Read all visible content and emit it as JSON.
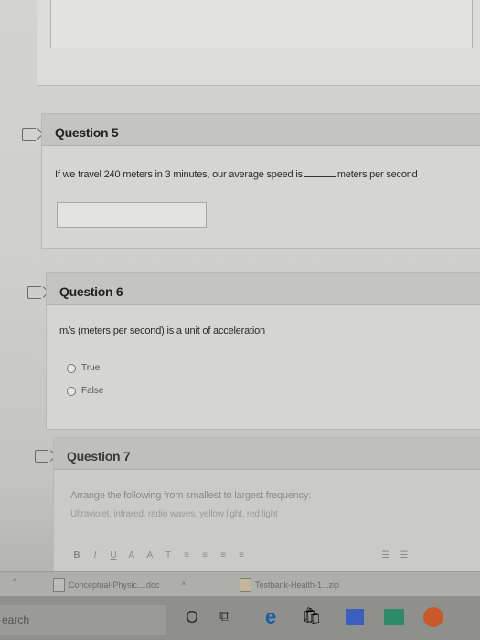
{
  "q5": {
    "title": "Question 5",
    "text_before": "If we travel 240 meters in 3 minutes, our average speed is",
    "text_after": "meters per second",
    "answer_value": ""
  },
  "q6": {
    "title": "Question 6",
    "text": "m/s (meters per second) is a unit of acceleration",
    "options": [
      "True",
      "False"
    ]
  },
  "q7": {
    "title": "Question 7",
    "text": "Arrange the following from smallest to largest frequency:",
    "items": "Ultraviolet, infrared, radio waves, yellow light, red light"
  },
  "editor_toolbar": {
    "bold": "B",
    "italic": "I",
    "underline": "U",
    "font_color": "A",
    "highlight": "A",
    "clear_format": "T",
    "align_left": "≡",
    "align_center": "≡",
    "align_right": "≡",
    "justify": "≡",
    "list_bullets": "☰",
    "list_numbers": "☰"
  },
  "downloads": [
    {
      "name": "Conceptual-Physic....doc"
    },
    {
      "name": "Testbank-Health-1...zip"
    }
  ],
  "taskbar": {
    "search_placeholder": "earch",
    "cortana_icon": "O",
    "taskview_icon": "⧉",
    "edge_icon": "e",
    "store_icon": "🛍"
  },
  "colors": {
    "page_bg": "#cfcfcb",
    "header_bg": "#c4c4c0",
    "taskbar_bg": "#8f8f8b"
  }
}
